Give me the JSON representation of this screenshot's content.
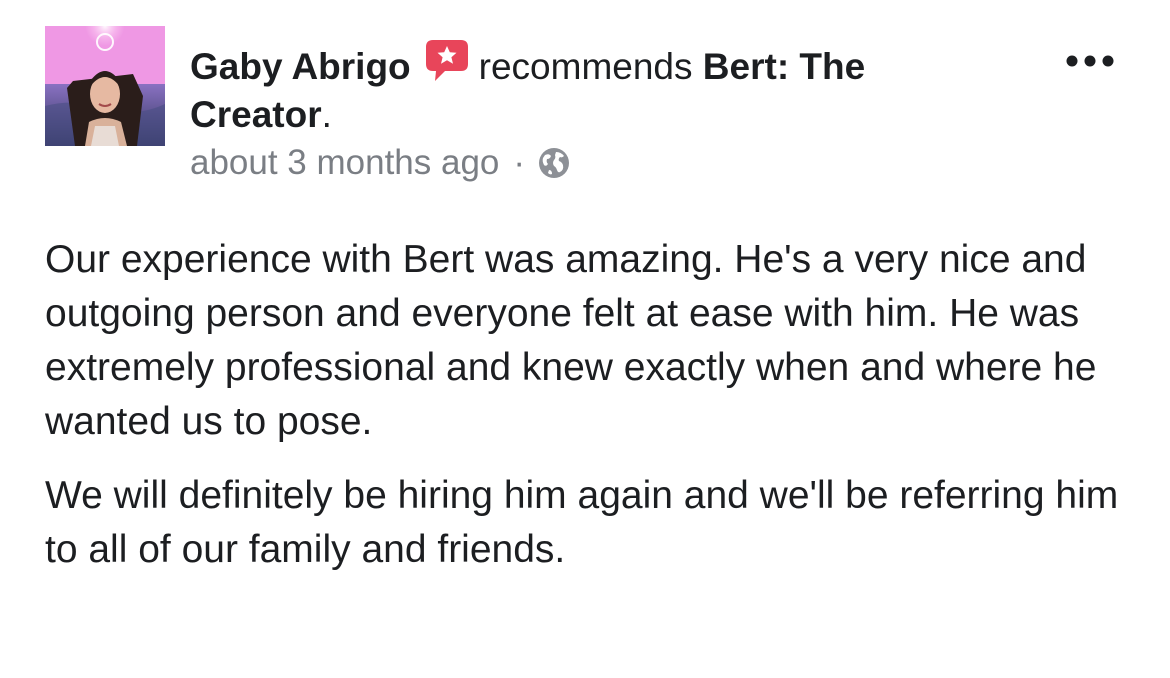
{
  "post": {
    "author_name": "Gaby Abrigo",
    "action_text": "recommends",
    "page_name": "Bert: The Creator",
    "period": ".",
    "timestamp": "about 3 months ago",
    "separator": "·",
    "privacy_icon": "globe-icon",
    "recommend_icon": "speech-bubble-star-icon",
    "more_icon": "ellipsis-icon",
    "paragraphs": [
      "Our experience with Bert was amazing. He's a very nice and outgoing person and everyone felt at ease with him. He was extremely professional and knew exactly when and where he wanted us to pose.",
      "We will definitely be hiring him again and we'll be referring him to all of our family and friends."
    ]
  },
  "colors": {
    "text": "#1c1e21",
    "meta_text": "#7a7e84",
    "recommend_icon": "#e8455a"
  }
}
